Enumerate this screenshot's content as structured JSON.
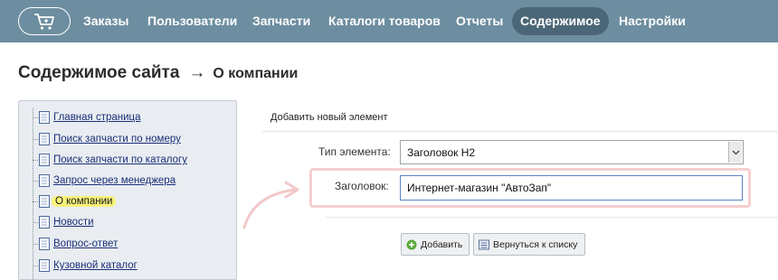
{
  "nav": {
    "items": [
      {
        "label": "Заказы",
        "active": false
      },
      {
        "label": "Пользователи",
        "active": false
      },
      {
        "label": "Запчасти",
        "active": false
      },
      {
        "label": "Каталоги товаров",
        "active": false
      },
      {
        "label": "Отчеты",
        "active": false
      },
      {
        "label": "Содержимое",
        "active": true
      },
      {
        "label": "Настройки",
        "active": false
      }
    ],
    "cart_icon": "cart-plus-icon"
  },
  "heading": {
    "main": "Содержимое сайта",
    "arrow": "→",
    "sub": "О компании"
  },
  "sidebar": {
    "items": [
      {
        "label": "Главная страница",
        "current": false
      },
      {
        "label": "Поиск запчасти по номеру",
        "current": false
      },
      {
        "label": "Поиск запчасти по каталогу",
        "current": false
      },
      {
        "label": "Запрос через менеджера",
        "current": false
      },
      {
        "label": "О компании",
        "current": true
      },
      {
        "label": "Новости",
        "current": false
      },
      {
        "label": "Вопрос-ответ",
        "current": false
      },
      {
        "label": "Кузовной каталог",
        "current": false
      }
    ]
  },
  "form": {
    "title": "Добавить новый элемент",
    "type_label": "Тип элемента:",
    "type_value": "Заголовок H2",
    "heading_label": "Заголовок:",
    "heading_value": "Интернет-магазин \"АвтоЗап\"",
    "add_button": "Добавить",
    "back_button": "Вернуться к списку"
  },
  "colors": {
    "nav_bg": "#6d8ea0",
    "nav_active": "#4b6777",
    "highlight": "#f7f27a",
    "annotation": "#f6cfcf"
  }
}
